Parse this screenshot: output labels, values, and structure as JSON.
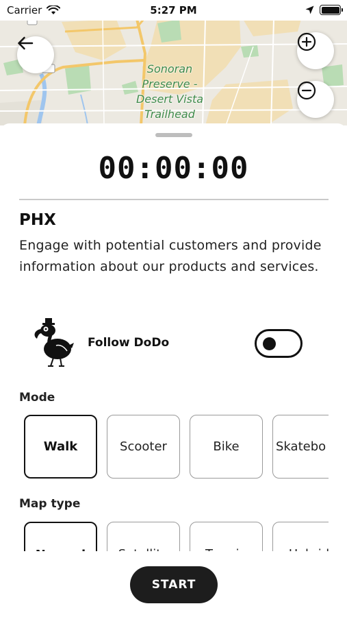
{
  "status_bar": {
    "carrier": "Carrier",
    "time": "5:27 PM",
    "icons": [
      "wifi-icon",
      "location-arrow-icon",
      "battery-icon"
    ]
  },
  "map": {
    "place_label": "Sonoran Preserve -Desert Vista Trailhead",
    "buttons": [
      "back-arrow-icon",
      "zoom-in-icon",
      "zoom-out-icon"
    ],
    "colors": {
      "land": "#ece9e1",
      "desert": "#f1dfb6",
      "park": "#b9dcb4",
      "road": "#f3c76a",
      "water": "#9fc5ee"
    }
  },
  "tracker": {
    "timer": "00:00:00",
    "title": "PHX",
    "description": "Engage with potential customers and provide information about our products and services.",
    "follow_label": "Follow DoDo",
    "follow_enabled": false
  },
  "mode": {
    "label": "Mode",
    "options": [
      {
        "label": "Walk",
        "selected": true
      },
      {
        "label": "Scooter",
        "selected": false
      },
      {
        "label": "Bike",
        "selected": false
      },
      {
        "label": "Skatebo",
        "selected": false
      }
    ]
  },
  "map_type": {
    "label": "Map type",
    "options": [
      {
        "label": "Normal",
        "selected": true
      },
      {
        "label": "Satellite",
        "selected": false
      },
      {
        "label": "Terrain",
        "selected": false
      },
      {
        "label": "Hybrid",
        "selected": false
      }
    ]
  },
  "actions": {
    "start_label": "START"
  },
  "colors": {
    "primary": "#1d1d1d",
    "chip_border": "#999999",
    "divider": "#c9c9c9"
  }
}
